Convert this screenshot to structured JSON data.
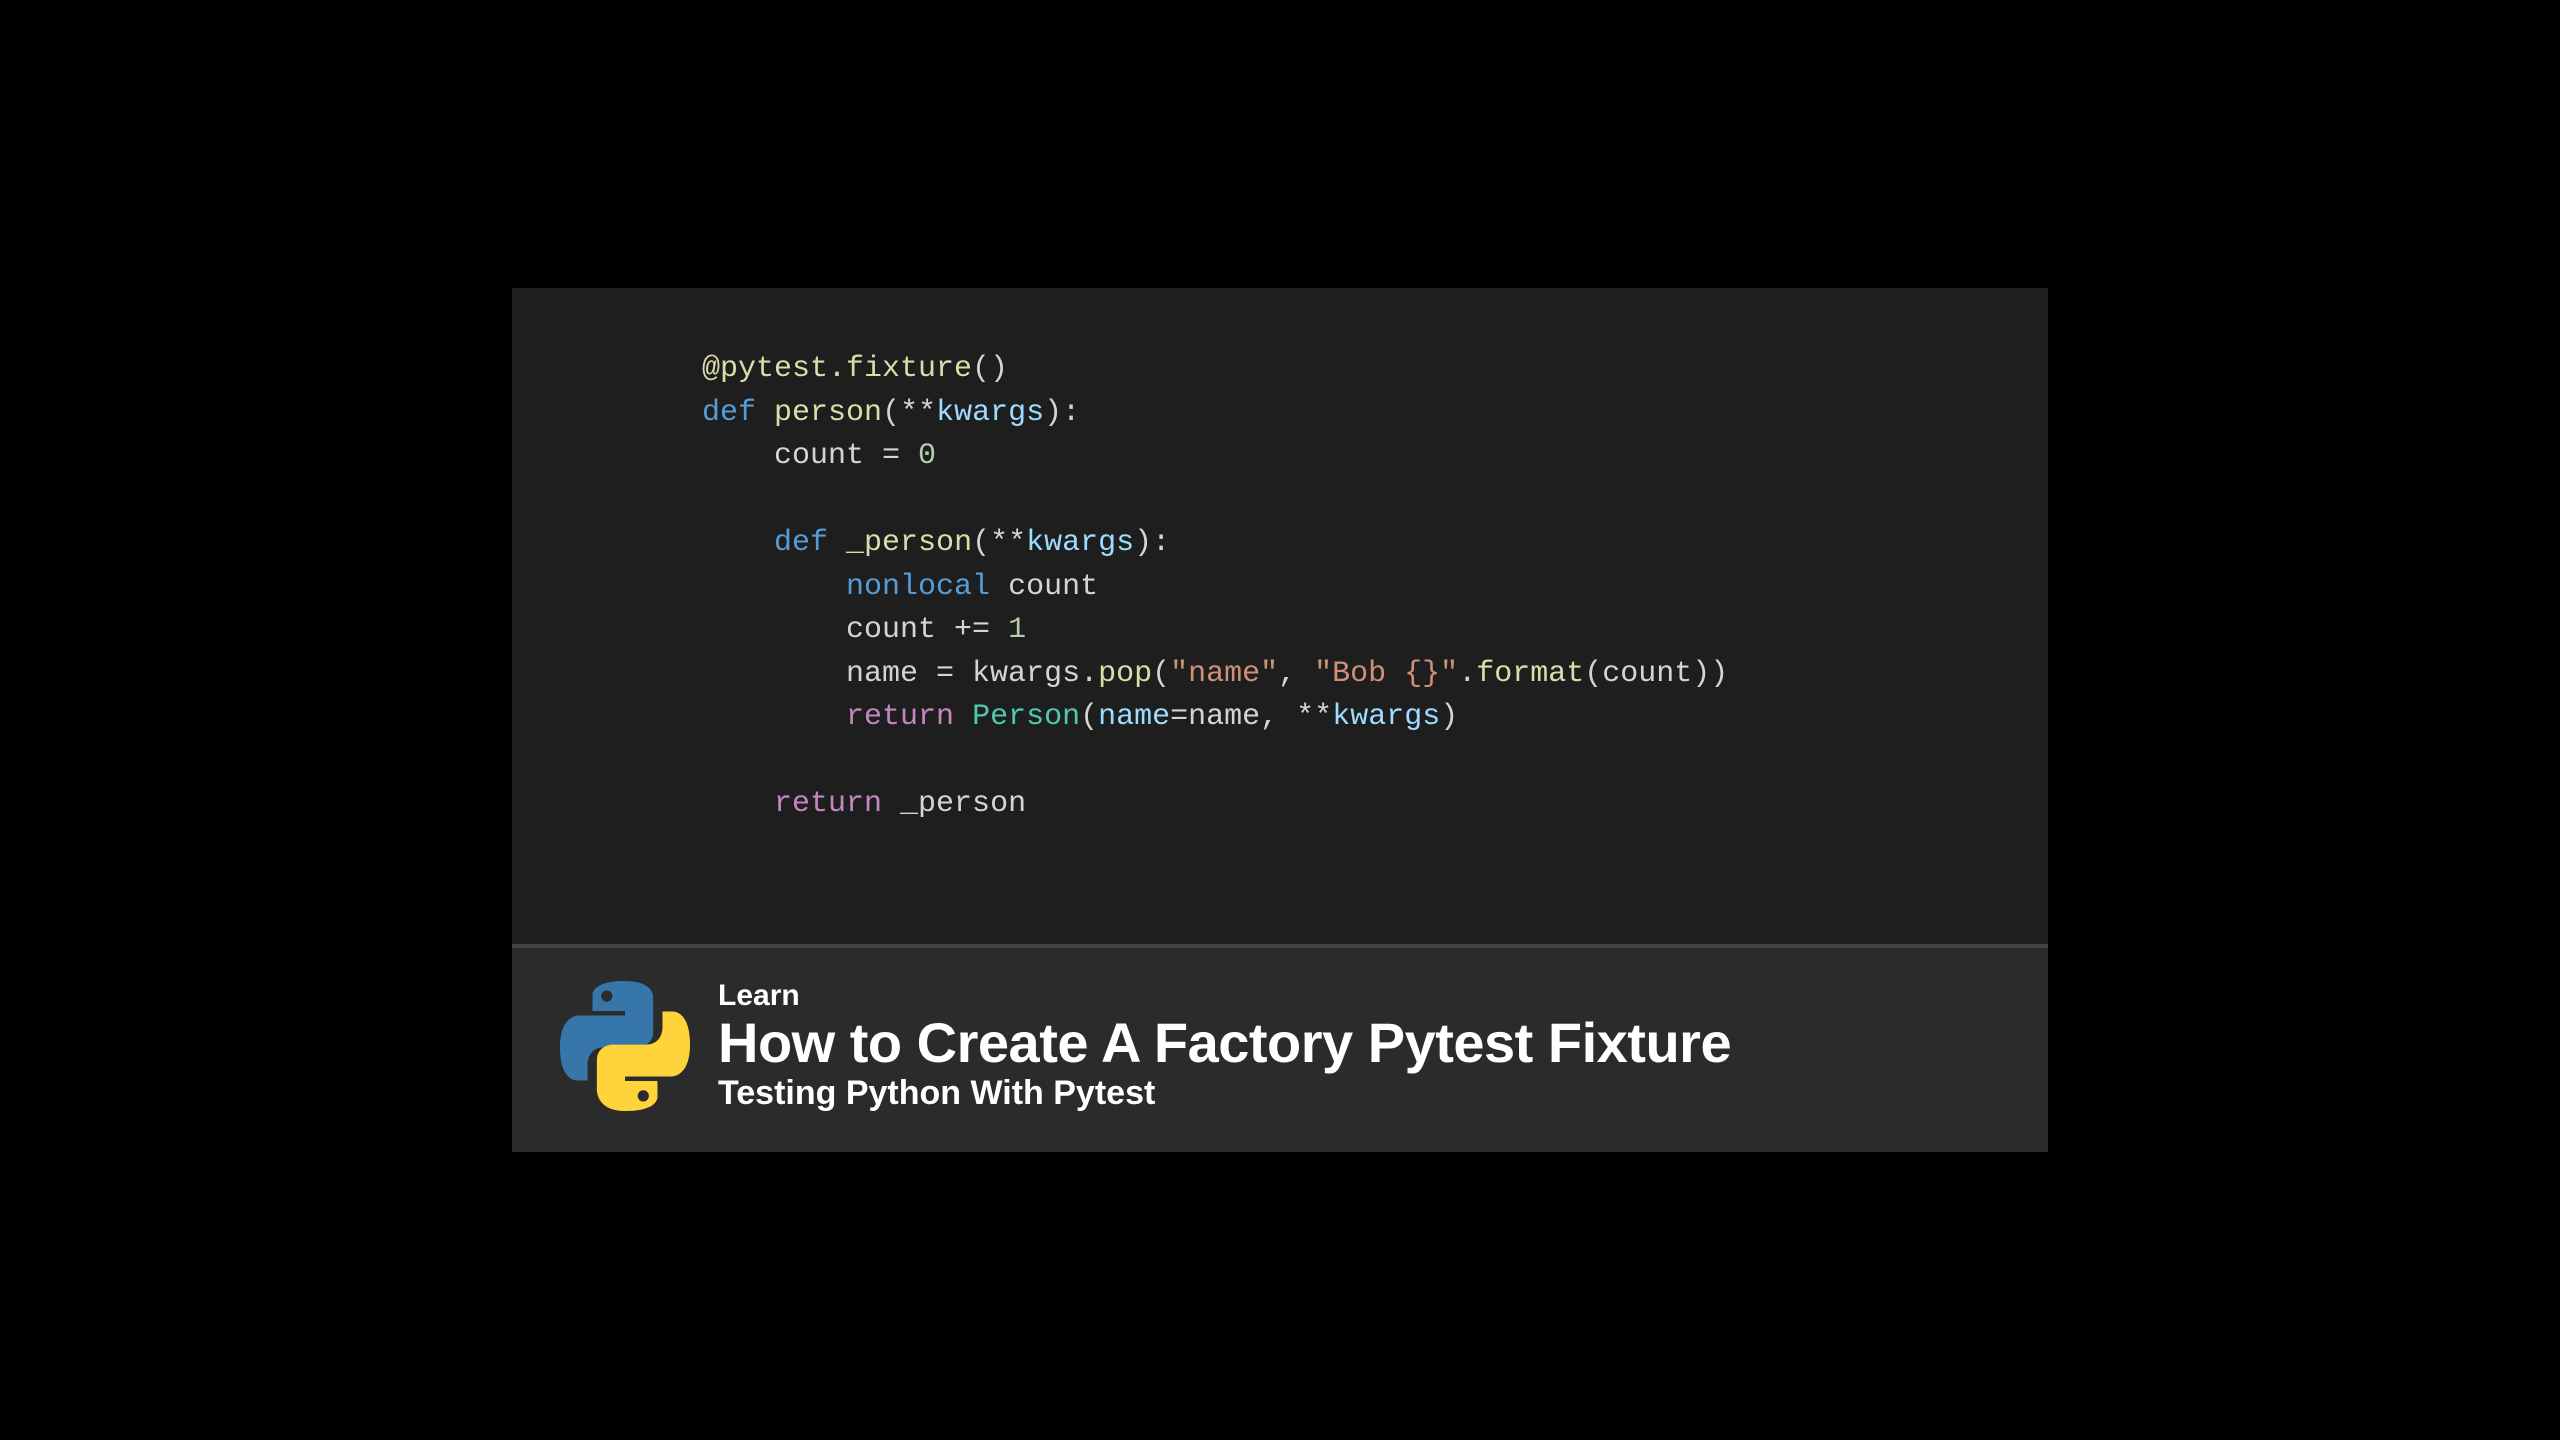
{
  "code": {
    "l1_decorator": "@pytest.fixture",
    "l1_paren": "()",
    "l2_def": "def",
    "l2_name": "person",
    "l2_params_open": "(**",
    "l2_param": "kwargs",
    "l2_params_close": "):",
    "l3_var": "count",
    "l3_eq": " = ",
    "l3_val": "0",
    "l4_def": "def",
    "l4_name": "_person",
    "l4_params_open": "(**",
    "l4_param": "kwargs",
    "l4_params_close": "):",
    "l5_kw": "nonlocal",
    "l5_var": " count",
    "l6_text": "count += ",
    "l6_val": "1",
    "l7_lhs": "name = kwargs.",
    "l7_pop": "pop",
    "l7_open": "(",
    "l7_str1": "\"name\"",
    "l7_comma": ", ",
    "l7_str2": "\"Bob {}\"",
    "l7_dot": ".",
    "l7_format": "format",
    "l7_open2": "(",
    "l7_count": "count",
    "l7_close": "))",
    "l8_ret": "return",
    "l8_sp": " ",
    "l8_class": "Person",
    "l8_open": "(",
    "l8_kw1": "name",
    "l8_eq": "=",
    "l8_val1": "name",
    "l8_comma": ", **",
    "l8_kw2": "kwargs",
    "l8_close": ")",
    "l9_ret": "return",
    "l9_val": " _person"
  },
  "banner": {
    "kicker": "Learn",
    "headline": "How to Create A Factory Pytest Fixture",
    "subhead": "Testing Python With Pytest"
  },
  "colors": {
    "code_bg": "#1e1e1e",
    "banner_bg": "#2b2b2b",
    "python_blue": "#3776ab",
    "python_yellow": "#ffd43b"
  }
}
